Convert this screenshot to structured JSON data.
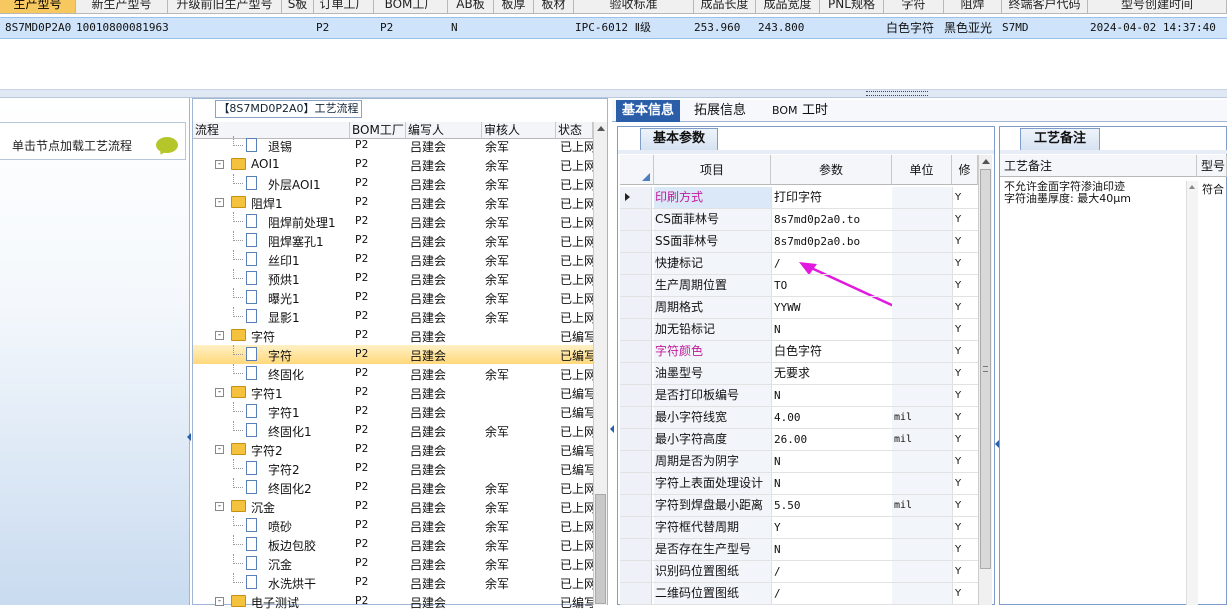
{
  "top_grid": {
    "headers": [
      "生产型号",
      "新生产型号",
      "升级前旧生产型号",
      "S板",
      "订单工厂",
      "BOM工厂",
      "AB板",
      "板厚",
      "板材",
      "验收标准",
      "成品长度",
      "成品宽度",
      "PNL规格",
      "字符",
      "阻焊",
      "终端客户代码",
      "型号创建时间"
    ],
    "row": {
      "production_model": "8S7MD0P2A0",
      "new_model": "10010800081963",
      "order_factory": "P2",
      "bom_factory": "P2",
      "ab_board": "N",
      "standard": "IPC-6012 Ⅱ级",
      "length": "253.960",
      "width": "243.800",
      "character": "白色字符",
      "solder_mask": "黑色亚光",
      "customer_code": "S7MD",
      "created": "2024-04-02 14:37:40"
    }
  },
  "left_panel": {
    "hint": "单击节点加载工艺流程"
  },
  "tree": {
    "title": "【8S7MD0P2A0】工艺流程",
    "columns": [
      "流程",
      "BOM工厂",
      "编写人",
      "审核人",
      "状态"
    ],
    "rows": [
      {
        "level": 2,
        "type": "doc",
        "name": "退锡",
        "bom": "P2",
        "author": "吕建会",
        "reviewer": "余军",
        "status": "已上网"
      },
      {
        "level": 1,
        "type": "folder",
        "name": "AOI1",
        "bom": "P2",
        "author": "吕建会",
        "reviewer": "余军",
        "status": "已上网"
      },
      {
        "level": 2,
        "type": "doc",
        "name": "外层AOI1",
        "bom": "P2",
        "author": "吕建会",
        "reviewer": "余军",
        "status": "已上网"
      },
      {
        "level": 1,
        "type": "folder",
        "name": "阻焊1",
        "bom": "P2",
        "author": "吕建会",
        "reviewer": "余军",
        "status": "已上网"
      },
      {
        "level": 2,
        "type": "doc",
        "name": "阻焊前处理1",
        "bom": "P2",
        "author": "吕建会",
        "reviewer": "余军",
        "status": "已上网"
      },
      {
        "level": 2,
        "type": "doc",
        "name": "阻焊塞孔1",
        "bom": "P2",
        "author": "吕建会",
        "reviewer": "余军",
        "status": "已上网"
      },
      {
        "level": 2,
        "type": "doc",
        "name": "丝印1",
        "bom": "P2",
        "author": "吕建会",
        "reviewer": "余军",
        "status": "已上网"
      },
      {
        "level": 2,
        "type": "doc",
        "name": "预烘1",
        "bom": "P2",
        "author": "吕建会",
        "reviewer": "余军",
        "status": "已上网"
      },
      {
        "level": 2,
        "type": "doc",
        "name": "曝光1",
        "bom": "P2",
        "author": "吕建会",
        "reviewer": "余军",
        "status": "已上网"
      },
      {
        "level": 2,
        "type": "doc",
        "name": "显影1",
        "bom": "P2",
        "author": "吕建会",
        "reviewer": "余军",
        "status": "已上网"
      },
      {
        "level": 1,
        "type": "folder",
        "name": "字符",
        "bom": "P2",
        "author": "吕建会",
        "reviewer": "",
        "status": "已编写"
      },
      {
        "level": 2,
        "type": "doc",
        "name": "字符",
        "bom": "P2",
        "author": "吕建会",
        "reviewer": "",
        "status": "已编写",
        "highlight": true
      },
      {
        "level": 2,
        "type": "doc",
        "name": "终固化",
        "bom": "P2",
        "author": "吕建会",
        "reviewer": "余军",
        "status": "已上网"
      },
      {
        "level": 1,
        "type": "folder",
        "name": "字符1",
        "bom": "P2",
        "author": "吕建会",
        "reviewer": "",
        "status": "已编写"
      },
      {
        "level": 2,
        "type": "doc",
        "name": "字符1",
        "bom": "P2",
        "author": "吕建会",
        "reviewer": "",
        "status": "已编写"
      },
      {
        "level": 2,
        "type": "doc",
        "name": "终固化1",
        "bom": "P2",
        "author": "吕建会",
        "reviewer": "余军",
        "status": "已上网"
      },
      {
        "level": 1,
        "type": "folder",
        "name": "字符2",
        "bom": "P2",
        "author": "吕建会",
        "reviewer": "",
        "status": "已编写"
      },
      {
        "level": 2,
        "type": "doc",
        "name": "字符2",
        "bom": "P2",
        "author": "吕建会",
        "reviewer": "",
        "status": "已编写"
      },
      {
        "level": 2,
        "type": "doc",
        "name": "终固化2",
        "bom": "P2",
        "author": "吕建会",
        "reviewer": "余军",
        "status": "已上网"
      },
      {
        "level": 1,
        "type": "folder",
        "name": "沉金",
        "bom": "P2",
        "author": "吕建会",
        "reviewer": "余军",
        "status": "已上网"
      },
      {
        "level": 2,
        "type": "doc",
        "name": "喷砂",
        "bom": "P2",
        "author": "吕建会",
        "reviewer": "余军",
        "status": "已上网"
      },
      {
        "level": 2,
        "type": "doc",
        "name": "板边包胶",
        "bom": "P2",
        "author": "吕建会",
        "reviewer": "余军",
        "status": "已上网"
      },
      {
        "level": 2,
        "type": "doc",
        "name": "沉金",
        "bom": "P2",
        "author": "吕建会",
        "reviewer": "余军",
        "status": "已上网"
      },
      {
        "level": 2,
        "type": "doc",
        "name": "水洗烘干",
        "bom": "P2",
        "author": "吕建会",
        "reviewer": "余军",
        "status": "已上网"
      },
      {
        "level": 1,
        "type": "folder",
        "name": "电子测试",
        "bom": "P2",
        "author": "吕建会",
        "reviewer": "",
        "status": "已编写"
      }
    ]
  },
  "tabs": [
    "基本信息",
    "拓展信息",
    "BOM",
    "工时"
  ],
  "basic_params": {
    "tab": "基本参数",
    "columns": [
      "项目",
      "参数",
      "单位",
      "修"
    ],
    "rows": [
      {
        "item": "印刷方式",
        "value": "打印字符",
        "unit": "",
        "flag": "Y",
        "pink": true,
        "current": true
      },
      {
        "item": "CS面菲林号",
        "value": "8s7md0p2a0.to",
        "unit": "",
        "flag": "Y"
      },
      {
        "item": "SS面菲林号",
        "value": "8s7md0p2a0.bo",
        "unit": "",
        "flag": "Y"
      },
      {
        "item": "快捷标记",
        "value": "/",
        "unit": "",
        "flag": "Y"
      },
      {
        "item": "生产周期位置",
        "value": "TO",
        "unit": "",
        "flag": "Y"
      },
      {
        "item": "周期格式",
        "value": "YYWW",
        "unit": "",
        "flag": "Y"
      },
      {
        "item": "加无铅标记",
        "value": "N",
        "unit": "",
        "flag": "Y"
      },
      {
        "item": "字符颜色",
        "value": "白色字符",
        "unit": "",
        "flag": "Y",
        "pink": true
      },
      {
        "item": "油墨型号",
        "value": "无要求",
        "unit": "",
        "flag": "Y"
      },
      {
        "item": "是否打印板编号",
        "value": "N",
        "unit": "",
        "flag": "Y"
      },
      {
        "item": "最小字符线宽",
        "value": "4.00",
        "unit": "mil",
        "flag": "Y"
      },
      {
        "item": "最小字符高度",
        "value": "26.00",
        "unit": "mil",
        "flag": "Y"
      },
      {
        "item": "周期是否为阴字",
        "value": "N",
        "unit": "",
        "flag": "Y"
      },
      {
        "item": "字符上表面处理设计",
        "value": "N",
        "unit": "",
        "flag": "Y"
      },
      {
        "item": "字符到焊盘最小距离",
        "value": "5.50",
        "unit": "mil",
        "flag": "Y"
      },
      {
        "item": "字符框代替周期",
        "value": "Y",
        "unit": "",
        "flag": "Y"
      },
      {
        "item": "是否存在生产型号",
        "value": "N",
        "unit": "",
        "flag": "Y"
      },
      {
        "item": "识别码位置图纸",
        "value": "/",
        "unit": "",
        "flag": "Y"
      },
      {
        "item": "二维码位置图纸",
        "value": "/",
        "unit": "",
        "flag": "Y"
      }
    ]
  },
  "process_notes": {
    "tab": "工艺备注",
    "columns": [
      "工艺备注",
      "型号"
    ],
    "text_line1": "不允许金面字符渗油印迹",
    "text_line2": "字符油墨厚度: 最大40μm",
    "model_cell": "符合"
  },
  "colors": {
    "accent": "#2b5ea8",
    "pink_label": "#c21b9c",
    "arrow": "#e21ae0",
    "highlight": "#ffd87a"
  }
}
